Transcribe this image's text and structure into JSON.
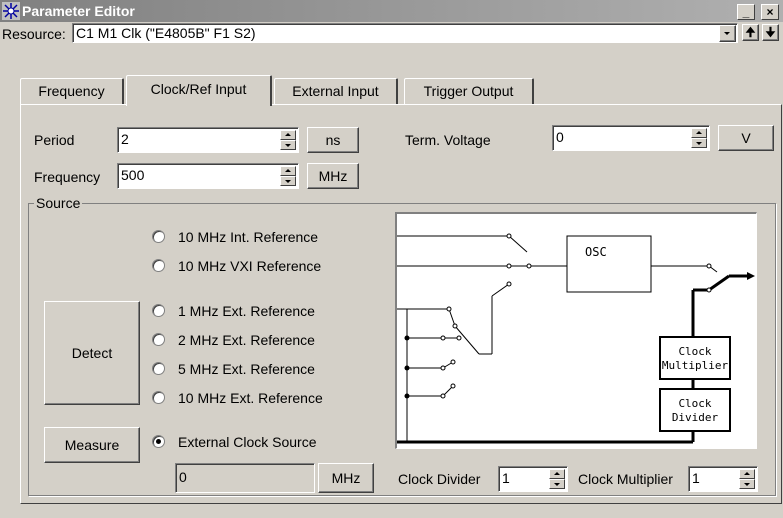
{
  "window": {
    "title": "Parameter Editor",
    "minimize_glyph": "_",
    "close_glyph": "×"
  },
  "resource": {
    "label": "Resource:",
    "value": "C1 M1 Clk (\"E4805B\" F1 S2)",
    "up_glyph": "🠉",
    "down_glyph": "🠋"
  },
  "tabs": [
    {
      "label": "Frequency"
    },
    {
      "label": "Clock/Ref Input"
    },
    {
      "label": "External Input"
    },
    {
      "label": "Trigger Output"
    }
  ],
  "period": {
    "label": "Period",
    "value": "2",
    "unit": "ns"
  },
  "frequency": {
    "label": "Frequency",
    "value": "500",
    "unit": "MHz"
  },
  "term_voltage": {
    "label": "Term. Voltage",
    "value": "0",
    "unit": "V"
  },
  "source": {
    "group_label": "Source",
    "detect_label": "Detect",
    "measure_label": "Measure",
    "options": [
      {
        "label": "10 MHz Int. Reference",
        "checked": false
      },
      {
        "label": "10 MHz VXI Reference",
        "checked": false
      },
      {
        "label": "1 MHz Ext. Reference",
        "checked": false
      },
      {
        "label": "2 MHz Ext. Reference",
        "checked": false
      },
      {
        "label": "5 MHz Ext. Reference",
        "checked": false
      },
      {
        "label": "10 MHz Ext. Reference",
        "checked": false
      },
      {
        "label": "External Clock Source",
        "checked": true
      }
    ],
    "measured_value": "0",
    "measured_unit": "MHz"
  },
  "diagram": {
    "osc_label": "OSC",
    "multiplier_label_1": "Clock",
    "multiplier_label_2": "Multiplier",
    "divider_label_1": "Clock",
    "divider_label_2": "Divider"
  },
  "clock_divider": {
    "label": "Clock Divider",
    "value": "1"
  },
  "clock_multiplier": {
    "label": "Clock Multiplier",
    "value": "1"
  },
  "colors": {
    "face": "#d4d0c8",
    "titlebar": "#808080"
  }
}
